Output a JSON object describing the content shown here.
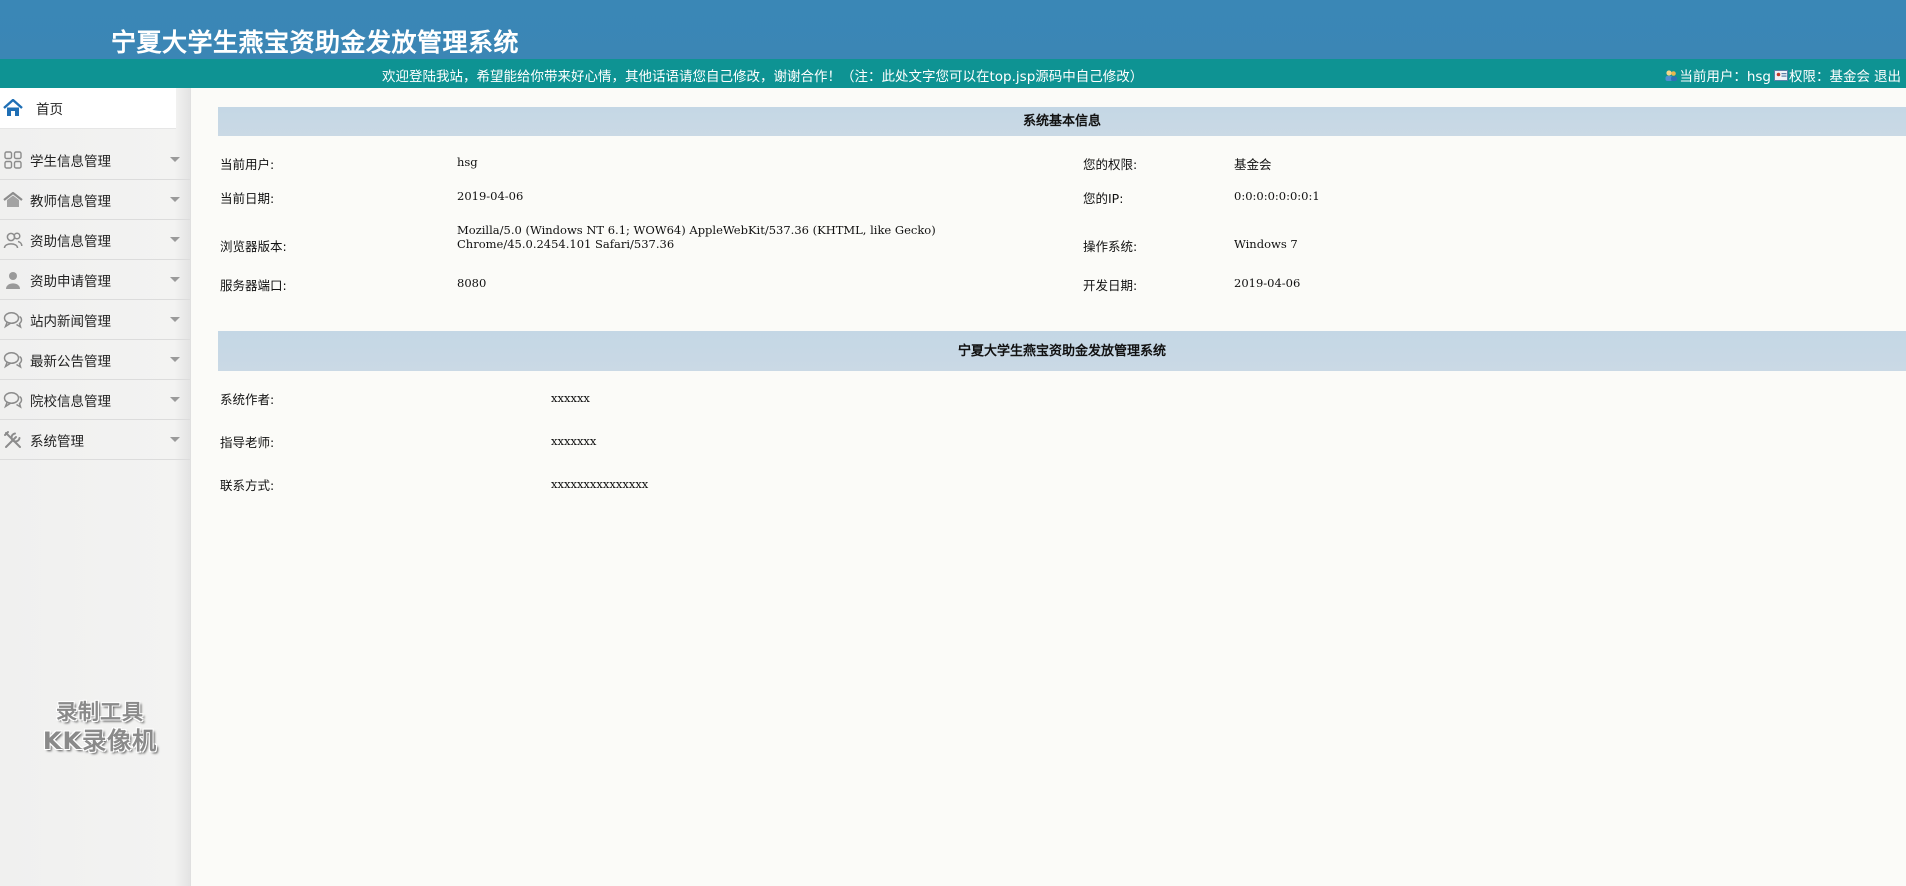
{
  "header": {
    "title": "宁夏大学生燕宝资助金发放管理系统"
  },
  "topbar": {
    "welcome": "欢迎登陆我站，希望能给你带来好心情，其他话语请您自己修改，谢谢合作！（注：此处文字您可以在top.jsp源码中自己修改）",
    "current_user_label": "当前用户：hsg",
    "role_label": "权限：基金会",
    "logout": "退出"
  },
  "sidebar": {
    "home": "首页",
    "items": [
      {
        "label": "学生信息管理",
        "icon": "grid-icon"
      },
      {
        "label": "教师信息管理",
        "icon": "house-icon"
      },
      {
        "label": "资助信息管理",
        "icon": "users-icon"
      },
      {
        "label": "资助申请管理",
        "icon": "person-icon"
      },
      {
        "label": "站内新闻管理",
        "icon": "chat-icon"
      },
      {
        "label": "最新公告管理",
        "icon": "chat-icon"
      },
      {
        "label": "院校信息管理",
        "icon": "chat-icon"
      },
      {
        "label": "系统管理",
        "icon": "tools-icon"
      }
    ],
    "watermark": {
      "line1": "录制工具",
      "line2": "KK录像机"
    }
  },
  "sysinfo": {
    "title": "系统基本信息",
    "current_user_label": "当前用户:",
    "current_user": "hsg",
    "role_label": "您的权限:",
    "role": "基金会",
    "date_label": "当前日期:",
    "date": "2019-04-06",
    "ip_label": "您的IP:",
    "ip": "0:0:0:0:0:0:0:1",
    "browser_label": "浏览器版本:",
    "browser": "Mozilla/5.0 (Windows NT 6.1; WOW64) AppleWebKit/537.36 (KHTML, like Gecko) Chrome/45.0.2454.101 Safari/537.36",
    "os_label": "操作系统:",
    "os": "Windows 7",
    "port_label": "服务器端口:",
    "port": "8080",
    "dev_date_label": "开发日期:",
    "dev_date": "2019-04-06"
  },
  "about": {
    "title": "宁夏大学生燕宝资助金发放管理系统",
    "author_label": "系统作者:",
    "author": "xxxxxx",
    "advisor_label": "指导老师:",
    "advisor": "xxxxxxx",
    "contact_label": "联系方式:",
    "contact": "xxxxxxxxxxxxxxx"
  },
  "colors": {
    "header_bg": "#3b87b6",
    "topbar_bg": "#0e9393",
    "section_head_bg": "#c8d9e5",
    "page_bg": "#fbfbf8"
  }
}
